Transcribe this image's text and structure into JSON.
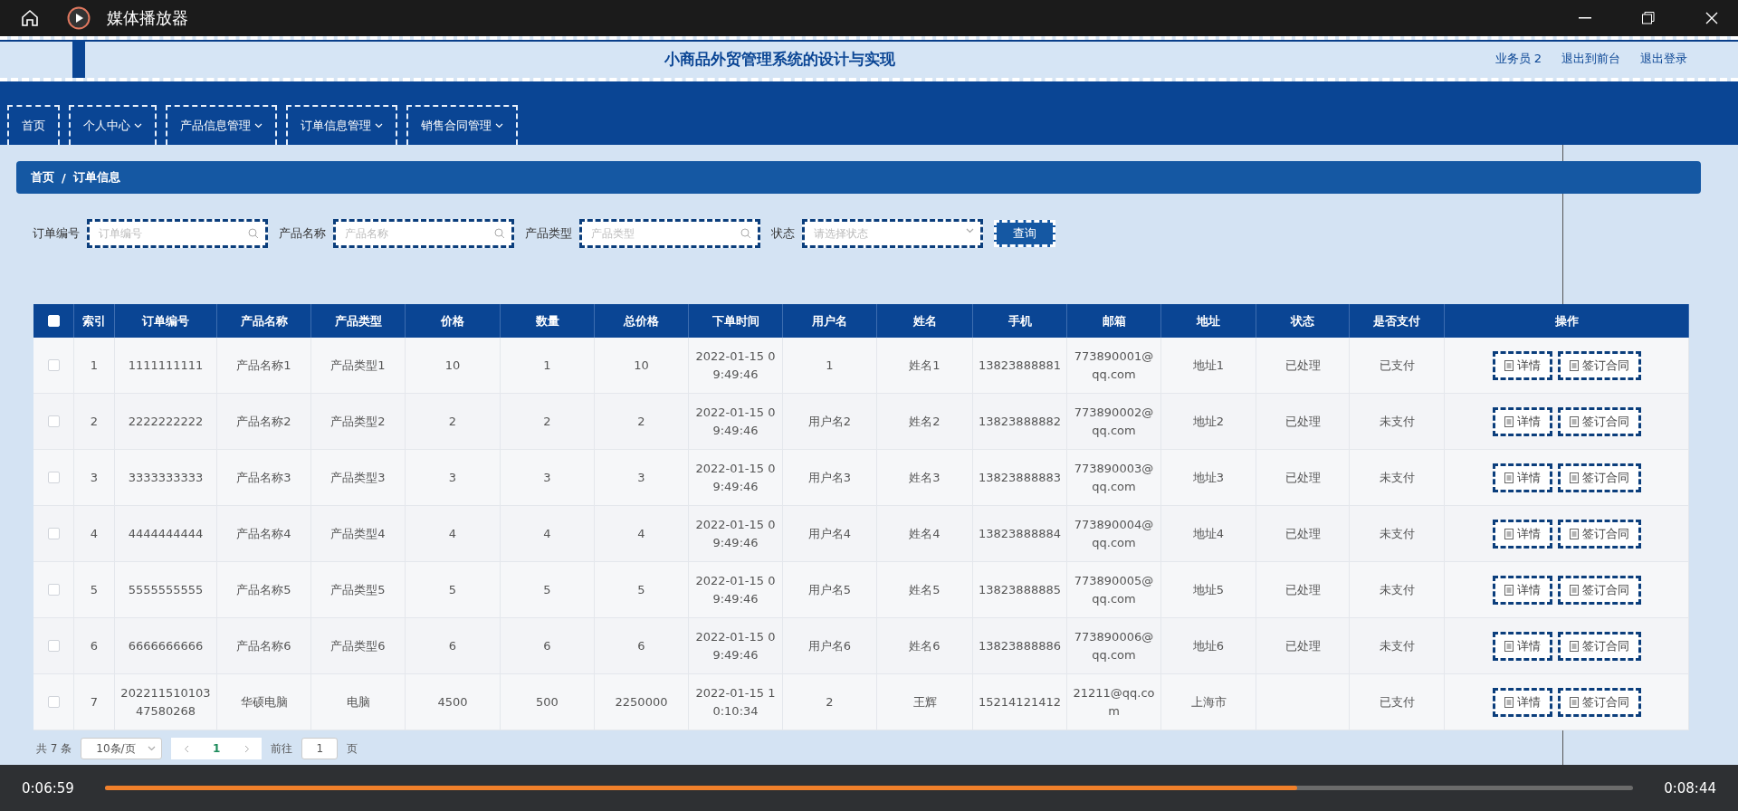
{
  "player": {
    "title": "媒体播放器",
    "current_time": "0:06:59",
    "total_time": "0:08:44",
    "level": 0.78
  },
  "header": {
    "title": "小商品外贸管理系统的设计与实现",
    "user": "业务员 2",
    "links": [
      "退出到前台",
      "退出登录"
    ]
  },
  "nav": [
    {
      "label": "首页",
      "hasMenu": false
    },
    {
      "label": "个人中心",
      "hasMenu": true
    },
    {
      "label": "产品信息管理",
      "hasMenu": true
    },
    {
      "label": "订单信息管理",
      "hasMenu": true
    },
    {
      "label": "销售合同管理",
      "hasMenu": true
    }
  ],
  "breadcrumb": [
    "首页",
    "/",
    "订单信息"
  ],
  "filters": [
    {
      "label": "订单编号",
      "placeholder": "订单编号",
      "kind": "search"
    },
    {
      "label": "产品名称",
      "placeholder": "产品名称",
      "kind": "search"
    },
    {
      "label": "产品类型",
      "placeholder": "产品类型",
      "kind": "search"
    },
    {
      "label": "状态",
      "placeholder": "请选择状态",
      "kind": "select"
    }
  ],
  "query_button": "查询",
  "table": {
    "all_checked": false,
    "columns": [
      "索引",
      "订单编号",
      "产品名称",
      "产品类型",
      "价格",
      "数量",
      "总价格",
      "下单时间",
      "用户名",
      "姓名",
      "手机",
      "邮箱",
      "地址",
      "状态",
      "是否支付",
      "操作"
    ],
    "rows": [
      {
        "checked": false,
        "cells": [
          "1",
          "1111111111",
          "产品名称1",
          "产品类型1",
          "10",
          "1",
          "10",
          "2022-01-15 09:49:46",
          "1",
          "姓名1",
          "13823888881",
          "773890001@qq.com",
          "地址1",
          "已处理",
          "已支付"
        ],
        "actions": [
          "详情",
          "签订合同"
        ]
      },
      {
        "checked": false,
        "cells": [
          "2",
          "2222222222",
          "产品名称2",
          "产品类型2",
          "2",
          "2",
          "2",
          "2022-01-15 09:49:46",
          "用户名2",
          "姓名2",
          "13823888882",
          "773890002@qq.com",
          "地址2",
          "已处理",
          "未支付"
        ],
        "actions": [
          "详情",
          "签订合同"
        ]
      },
      {
        "checked": false,
        "cells": [
          "3",
          "3333333333",
          "产品名称3",
          "产品类型3",
          "3",
          "3",
          "3",
          "2022-01-15 09:49:46",
          "用户名3",
          "姓名3",
          "13823888883",
          "773890003@qq.com",
          "地址3",
          "已处理",
          "未支付"
        ],
        "actions": [
          "详情",
          "签订合同"
        ]
      },
      {
        "checked": false,
        "cells": [
          "4",
          "4444444444",
          "产品名称4",
          "产品类型4",
          "4",
          "4",
          "4",
          "2022-01-15 09:49:46",
          "用户名4",
          "姓名4",
          "13823888884",
          "773890004@qq.com",
          "地址4",
          "已处理",
          "未支付"
        ],
        "actions": [
          "详情",
          "签订合同"
        ]
      },
      {
        "checked": false,
        "cells": [
          "5",
          "5555555555",
          "产品名称5",
          "产品类型5",
          "5",
          "5",
          "5",
          "2022-01-15 09:49:46",
          "用户名5",
          "姓名5",
          "13823888885",
          "773890005@qq.com",
          "地址5",
          "已处理",
          "未支付"
        ],
        "actions": [
          "详情",
          "签订合同"
        ]
      },
      {
        "checked": false,
        "cells": [
          "6",
          "6666666666",
          "产品名称6",
          "产品类型6",
          "6",
          "6",
          "6",
          "2022-01-15 09:49:46",
          "用户名6",
          "姓名6",
          "13823888886",
          "773890006@qq.com",
          "地址6",
          "已处理",
          "未支付"
        ],
        "actions": [
          "详情",
          "签订合同"
        ]
      },
      {
        "checked": false,
        "cells": [
          "7",
          "20221151010347580268",
          "华硕电脑",
          "电脑",
          "4500",
          "500",
          "2250000",
          "2022-01-15 10:10:34",
          "2",
          "王辉",
          "15214121412",
          "21211@qq.com",
          "上海市",
          "",
          "已支付"
        ],
        "actions": [
          "详情",
          "签订合同"
        ]
      }
    ]
  },
  "pagination": {
    "total": "共 7 条",
    "page_size": "10条/页",
    "pages": [
      {
        "label": "1",
        "selected": true
      }
    ],
    "goto_label": "前往",
    "goto_value": "1",
    "goto_suffix": "页"
  }
}
